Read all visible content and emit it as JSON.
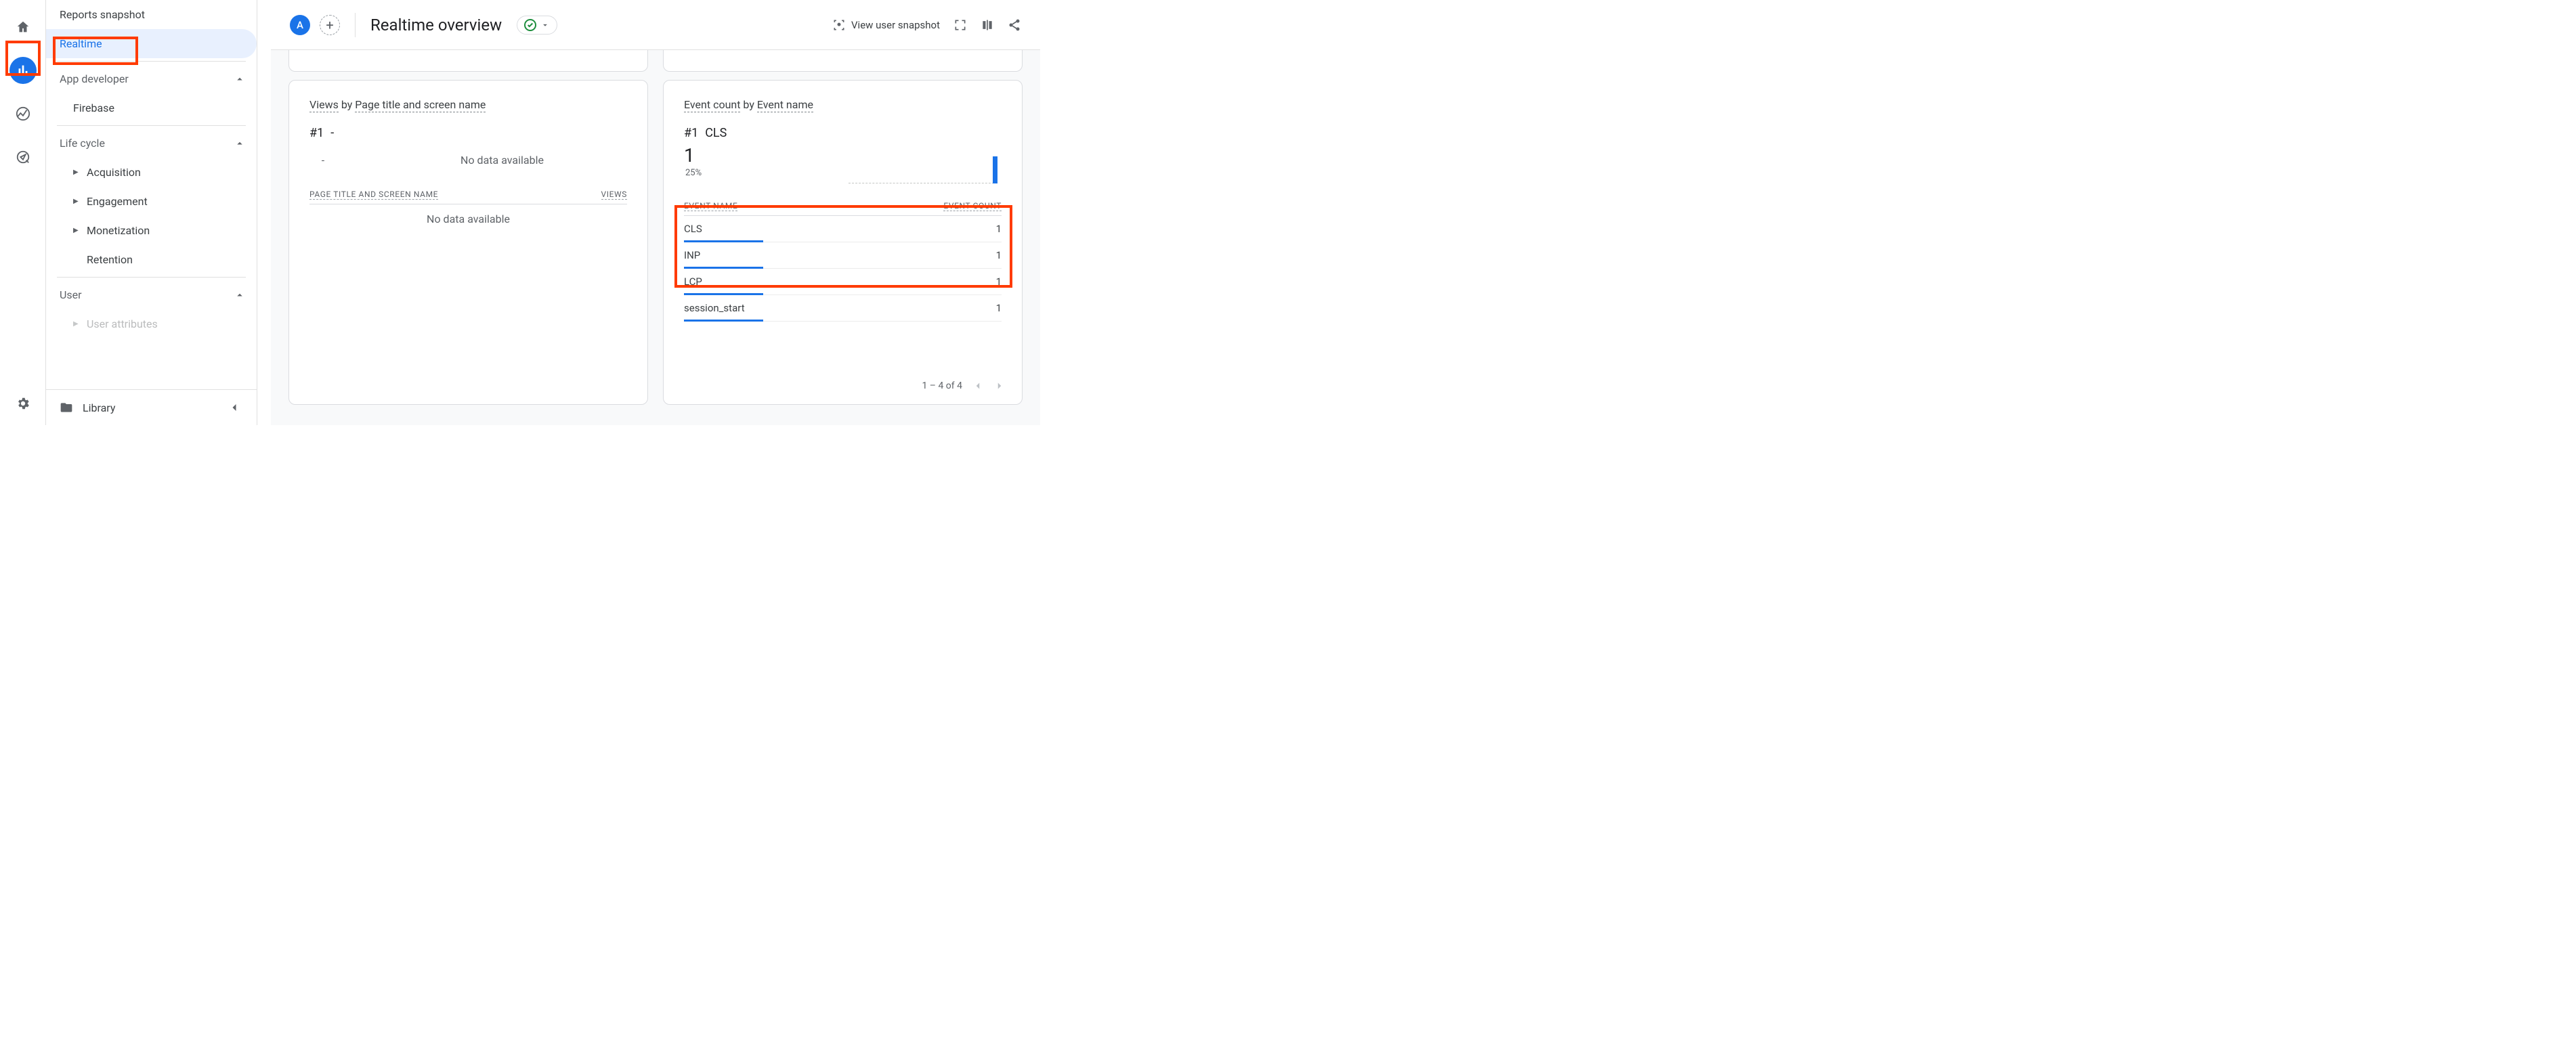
{
  "rail": {
    "items": [
      "home",
      "reports",
      "explore",
      "advertising"
    ],
    "activeIndex": 1
  },
  "sidebar": {
    "items": [
      {
        "label": "Reports snapshot"
      },
      {
        "label": "Realtime",
        "active": true
      }
    ],
    "sections": {
      "appdev": {
        "label": "App developer",
        "items": [
          "Firebase"
        ]
      },
      "lifecycle": {
        "label": "Life cycle",
        "items": [
          "Acquisition",
          "Engagement",
          "Monetization",
          "Retention"
        ]
      },
      "user": {
        "label": "User",
        "items": [
          "User attributes"
        ]
      }
    },
    "library": "Library"
  },
  "header": {
    "segment_letter": "A",
    "title": "Realtime overview",
    "snapshot_btn": "View user snapshot"
  },
  "views_card": {
    "title_a": "Views",
    "title_mid": " by ",
    "title_b": "Page title and screen name",
    "rank_label": "#1",
    "rank_value": "-",
    "no_data_sub": "No data available",
    "col_a": "PAGE TITLE AND SCREEN NAME",
    "col_b": "VIEWS",
    "no_data_body": "No data available",
    "sub_dash": "-"
  },
  "events_card": {
    "title_a": "Event count",
    "title_mid": " by ",
    "title_b": "Event name",
    "rank_label": "#1",
    "rank_value": "CLS",
    "big_value": "1",
    "pct": "25%",
    "col_a": "EVENT NAME",
    "col_b": "EVENT COUNT",
    "rows": [
      {
        "name": "CLS",
        "value": "1",
        "bar": 25
      },
      {
        "name": "INP",
        "value": "1",
        "bar": 25
      },
      {
        "name": "LCP",
        "value": "1",
        "bar": 25
      },
      {
        "name": "session_start",
        "value": "1",
        "bar": 25
      }
    ],
    "pager": "1 – 4 of 4"
  },
  "chart_data": {
    "type": "table",
    "title": "Event count by Event name",
    "xlabel": "Event name",
    "ylabel": "Event count",
    "categories": [
      "CLS",
      "INP",
      "LCP",
      "session_start"
    ],
    "values": [
      1,
      1,
      1,
      1
    ],
    "ylim": [
      0,
      4
    ],
    "note": "Sparkline bar at far right represents latest bucket = 1"
  }
}
